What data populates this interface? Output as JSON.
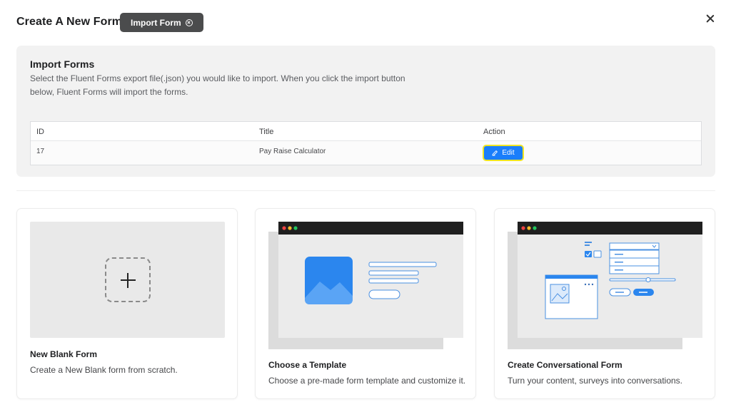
{
  "header": {
    "title": "Create A New Form",
    "import_button_label": "Import Form"
  },
  "import_panel": {
    "title": "Import Forms",
    "description": "Select the Fluent Forms export file(.json) you would like to import. When you click the import button below, Fluent Forms will import the forms.",
    "columns": [
      "ID",
      "Title",
      "Action"
    ],
    "rows": [
      {
        "id": "17",
        "title": "Pay Raise Calculator",
        "action_label": "Edit"
      }
    ]
  },
  "cards": [
    {
      "title": "New Blank Form",
      "description": "Create a New Blank form from scratch."
    },
    {
      "title": "Choose a Template",
      "description": "Choose a pre-made form template and customize it."
    },
    {
      "title": "Create Conversational Form",
      "description": "Turn your content, surveys into conversations."
    }
  ],
  "colors": {
    "accent": "#1a7efb",
    "highlight_border": "#f0e521",
    "dark_button": "#4b4c4d",
    "panel_bg": "#f2f2f2",
    "window_bar": "#1f1f1f",
    "dot_red": "#ef4444",
    "dot_yellow": "#f5b829",
    "dot_green": "#22c55e"
  },
  "icons": {
    "import_button_icon": "close-circle-icon",
    "close": "close-icon",
    "edit": "pencil-icon",
    "blank_form": "plus-icon"
  }
}
